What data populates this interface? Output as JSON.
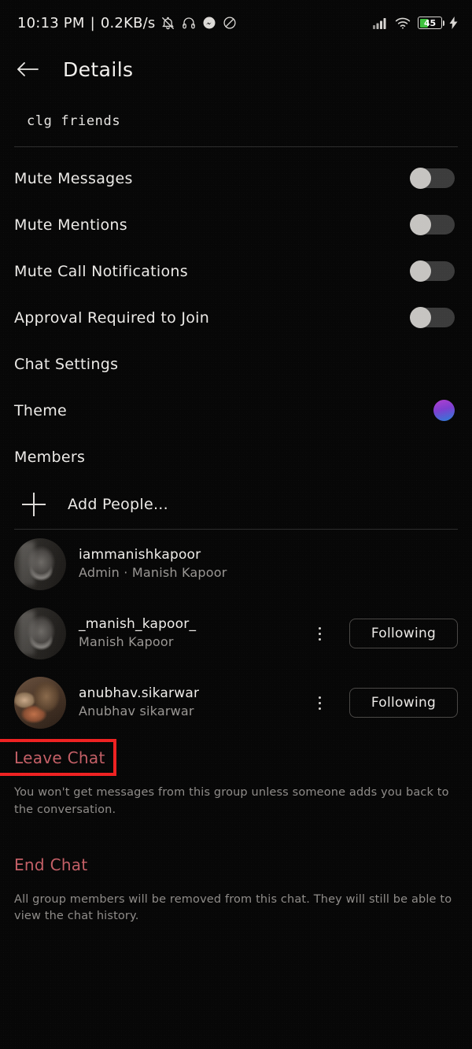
{
  "status_bar": {
    "clock": "10:13 PM",
    "separator": "|",
    "net_speed": "0.2KB/s",
    "left_icons": [
      "bell-muted-icon",
      "headphone-icon",
      "messenger-icon",
      "dnd-icon"
    ],
    "right_icons": [
      "signal-icon",
      "wifi-icon",
      "battery-icon",
      "charging-bolt-icon"
    ],
    "battery_level": "45"
  },
  "header": {
    "back_icon": "back-arrow-icon",
    "title": "Details"
  },
  "chat": {
    "name": "clg friends"
  },
  "settings": [
    {
      "label": "Mute Messages",
      "control": "toggle",
      "state": "off"
    },
    {
      "label": "Mute Mentions",
      "control": "toggle",
      "state": "off"
    },
    {
      "label": "Mute Call Notifications",
      "control": "toggle",
      "state": "off"
    },
    {
      "label": "Approval Required to Join",
      "control": "toggle",
      "state": "off"
    },
    {
      "label": "Chat Settings",
      "control": "none",
      "state": ""
    },
    {
      "label": "Theme",
      "control": "swatch",
      "state": ""
    },
    {
      "label": "Members",
      "control": "none",
      "state": ""
    }
  ],
  "add_people": {
    "label": "Add People...",
    "icon": "plus-icon"
  },
  "members": [
    {
      "username": "iammanishkapoor",
      "subtitle": "Admin · Manish Kapoor",
      "avatar": "av-manish",
      "has_menu": false,
      "action_label": ""
    },
    {
      "username": "_manish_kapoor_",
      "subtitle": "Manish Kapoor",
      "avatar": "av-manish",
      "has_menu": true,
      "action_label": "Following"
    },
    {
      "username": "anubhav.sikarwar",
      "subtitle": "Anubhav sikarwar",
      "avatar": "av-anubhav",
      "has_menu": true,
      "action_label": "Following"
    }
  ],
  "danger": {
    "leave_chat_label": "Leave Chat",
    "leave_chat_desc": "You won't get messages from this group unless someone adds you back to the conversation.",
    "end_chat_label": "End Chat",
    "end_chat_desc": "All group members will be removed from this chat. They will still be able to view the chat history."
  },
  "colors": {
    "background": "#070707",
    "text_primary": "#ecEAE7",
    "text_secondary": "#9a9794",
    "danger_text": "#c45f66",
    "highlight_border": "#ef2222",
    "toggle_track": "#3c3c3c",
    "toggle_knob": "#c6c4c1",
    "theme_swatch_from": "#b13fd0",
    "theme_swatch_to": "#2a7fd8",
    "battery_green": "#3ec13e"
  }
}
